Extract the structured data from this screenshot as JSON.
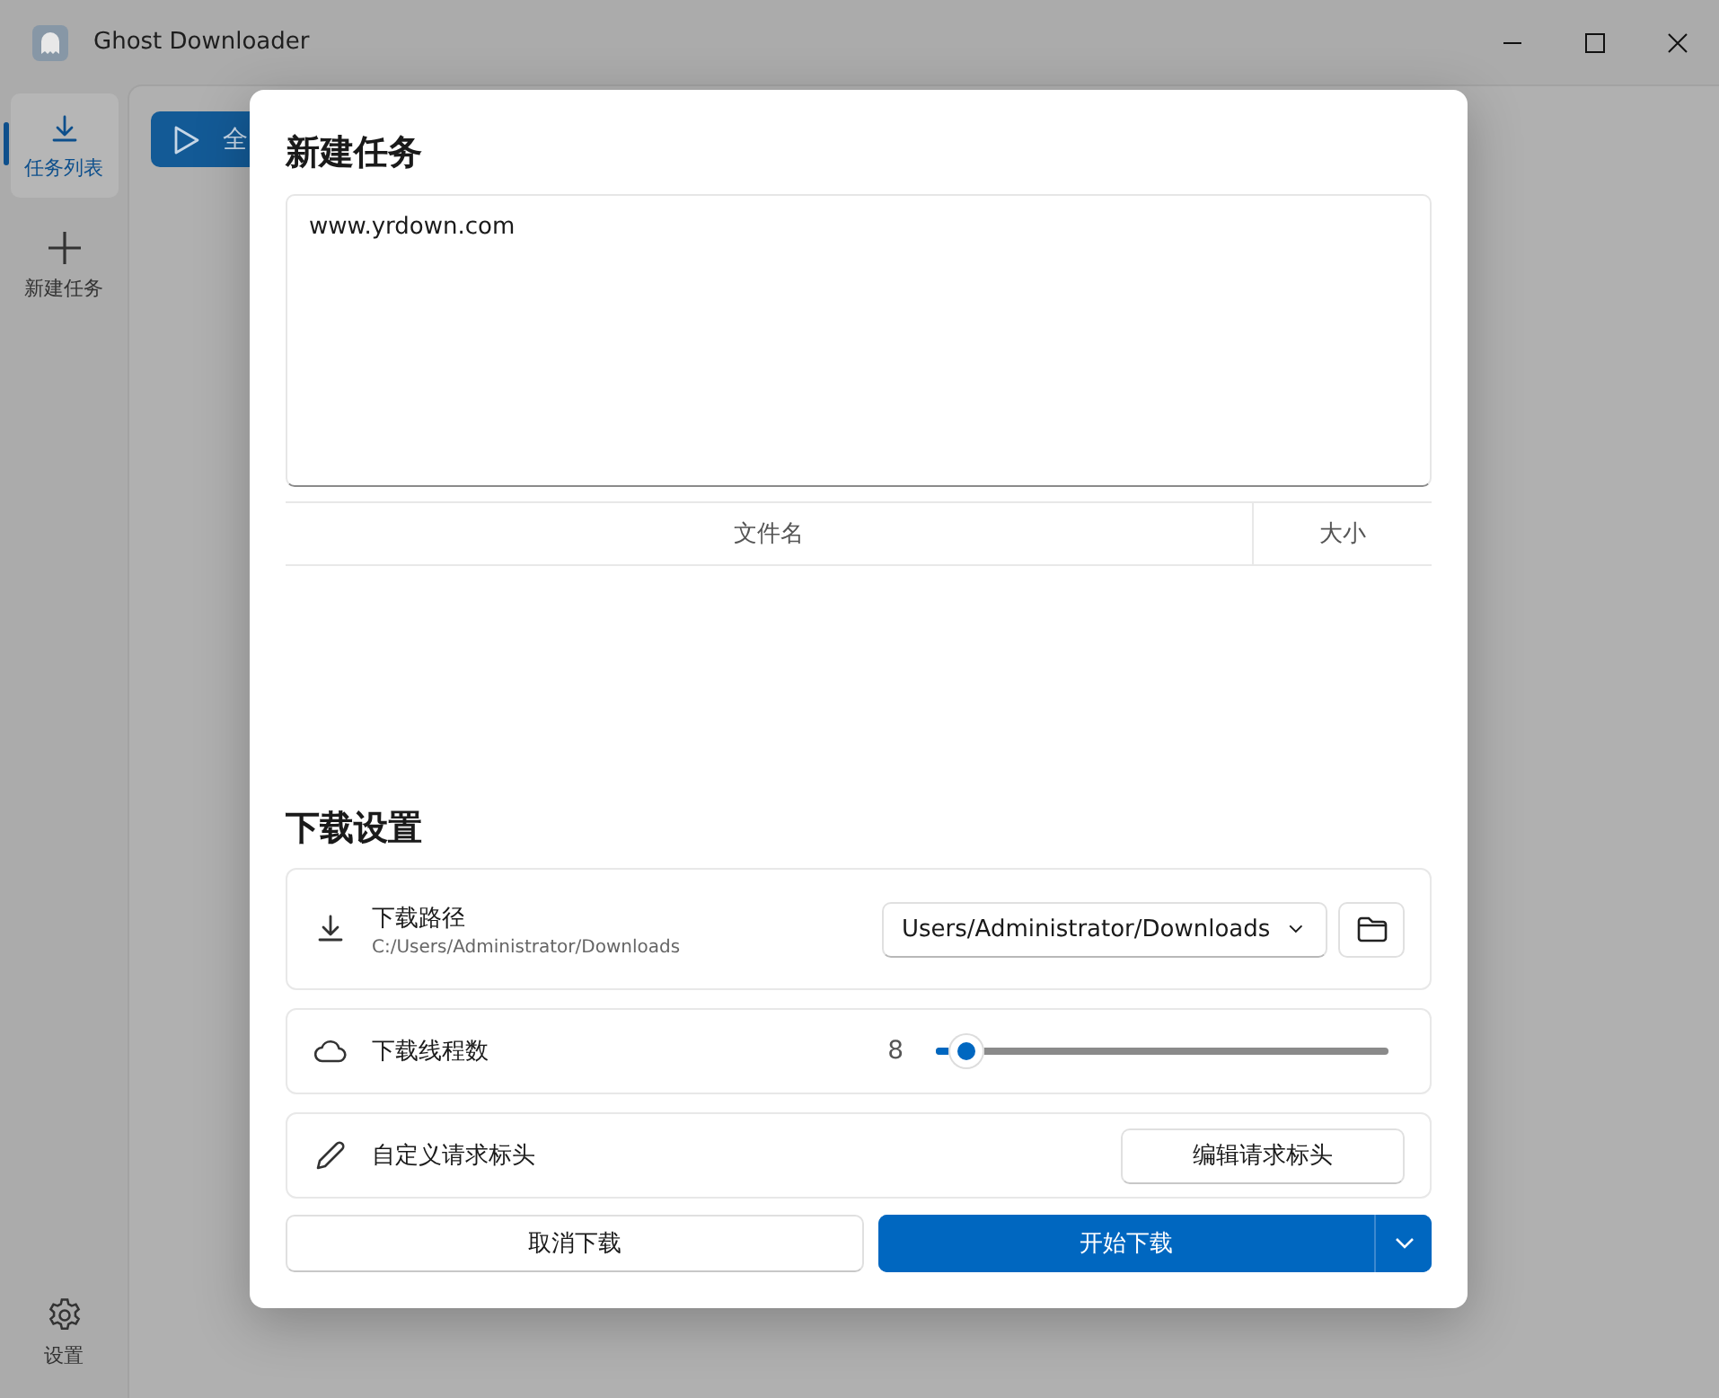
{
  "window": {
    "title": "Ghost Downloader"
  },
  "sidebar": {
    "items": [
      {
        "label": "任务列表",
        "selected": true
      },
      {
        "label": "新建任务",
        "selected": false
      }
    ],
    "footer_items": [
      {
        "label": "设置",
        "selected": false
      }
    ]
  },
  "toolbar": {
    "button": "全"
  },
  "dialog": {
    "title": "新建任务",
    "url_input": {
      "value": "www.yrdown.com"
    },
    "file_table": {
      "columns": [
        "文件名",
        "大小"
      ]
    },
    "settings_title": "下载设置",
    "settings": [
      {
        "kind": "folder",
        "title": "下载路径",
        "subtitle": "C:/Users/Administrator/Downloads",
        "value": "Users/Administrator/Downloads"
      },
      {
        "kind": "slider",
        "title": "下载线程数",
        "reading": "8",
        "level": 0.03
      },
      {
        "kind": "button",
        "title": "自定义请求标头",
        "button": "编辑请求标头"
      }
    ],
    "buttons": {
      "cancel": "取消下载",
      "start": "开始下载"
    }
  }
}
